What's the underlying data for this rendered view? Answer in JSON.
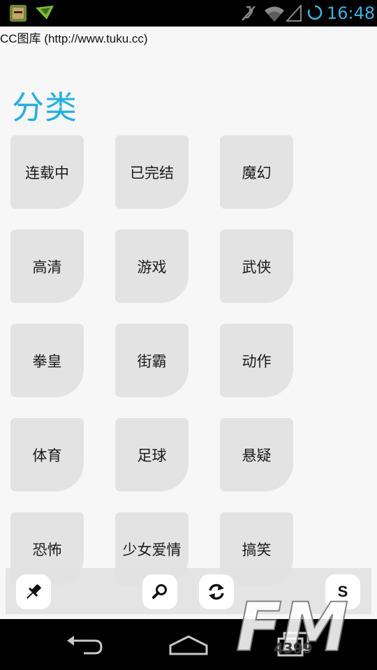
{
  "status_bar": {
    "time": "16:48",
    "icons": [
      "game-notification-icon",
      "download-notification-icon",
      "mute-icon",
      "wifi-icon",
      "signal-icon",
      "sync-icon"
    ],
    "accent_color": "#33b5e5"
  },
  "page": {
    "title_line": "CC图库 (http://www.tuku.cc)",
    "section_heading": "分类",
    "heading_color": "#1fb1e6",
    "background": "#f7f7f7",
    "tile_color": "#e3e3e3"
  },
  "categories": [
    {
      "label": "连载中"
    },
    {
      "label": "已完结"
    },
    {
      "label": "魔幻"
    },
    {
      "label": "高清"
    },
    {
      "label": "游戏"
    },
    {
      "label": "武侠"
    },
    {
      "label": "拳皇"
    },
    {
      "label": "街霸"
    },
    {
      "label": "动作"
    },
    {
      "label": "体育"
    },
    {
      "label": "足球"
    },
    {
      "label": "悬疑"
    },
    {
      "label": "恐怖"
    },
    {
      "label": "少女爱情"
    },
    {
      "label": "搞笑"
    }
  ],
  "action_bar": {
    "buttons": [
      {
        "icon": "pin-icon"
      },
      {
        "icon": "search-icon"
      },
      {
        "icon": "refresh-icon"
      },
      {
        "icon": "s-icon",
        "label": "S"
      }
    ]
  },
  "nav_bar": {
    "icons": [
      "back-icon",
      "home-icon",
      "recents-icon"
    ]
  },
  "watermark": {
    "text": "FM",
    "subtext": "4399"
  }
}
